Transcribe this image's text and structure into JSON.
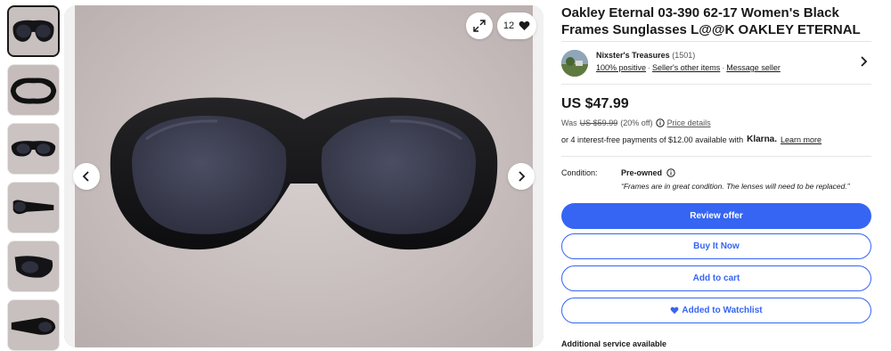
{
  "listing": {
    "title": "Oakley Eternal 03-390 62-17 Women's Black Frames Sunglasses L@@K OAKLEY ETERNAL",
    "watch_count": "12"
  },
  "seller": {
    "name": "Nixster's Treasures",
    "feedback_count": "(1501)",
    "positive": "100% positive",
    "other_items": "Seller's other items",
    "message": "Message seller"
  },
  "pricing": {
    "price": "US $47.99",
    "was_label": "Was",
    "was_price": "US $59.99",
    "discount": "(20% off)",
    "price_details": "Price details",
    "klarna_text": "or 4 interest-free payments of $12.00 available with",
    "klarna_brand": "Klarna.",
    "learn_more": "Learn more"
  },
  "condition": {
    "label": "Condition:",
    "value": "Pre-owned",
    "quote": "“Frames are in great condition. The lenses will need to be replaced.”"
  },
  "actions": {
    "review_offer": "Review offer",
    "buy_now": "Buy It Now",
    "add_to_cart": "Add to cart",
    "added_to_watchlist": "Added to Watchlist"
  },
  "additional_service": "Additional service available",
  "colors": {
    "primary_blue": "#3665f3",
    "text": "#191919"
  },
  "icons": {
    "expand": "expand-icon",
    "heart": "heart-icon",
    "chevron_left": "chevron-left-icon",
    "chevron_right": "chevron-right-icon",
    "info": "info-icon"
  }
}
